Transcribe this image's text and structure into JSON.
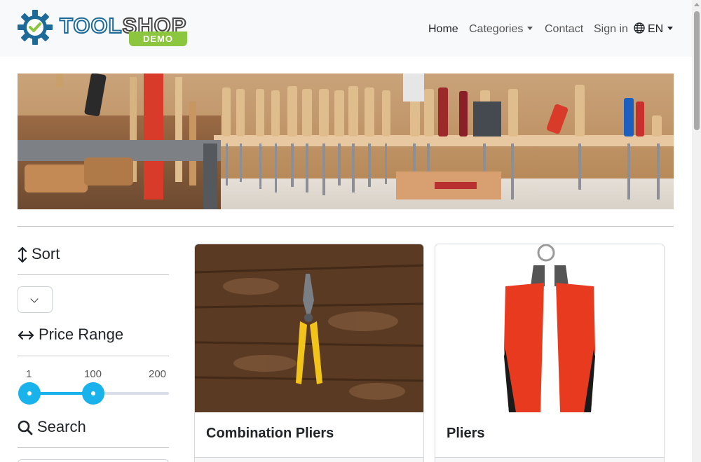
{
  "brand": {
    "name_part1": "TOOL",
    "name_part2": "SHOP",
    "tag": "DEMO"
  },
  "nav": {
    "home": "Home",
    "categories": "Categories",
    "contact": "Contact",
    "sign_in": "Sign in",
    "language": "EN"
  },
  "sidebar": {
    "sort_heading": "Sort",
    "sort_value": "",
    "price_heading": "Price Range",
    "price_min_label": "1",
    "price_current_label": "100",
    "price_max_label": "200",
    "price_range": {
      "min": 1,
      "low": 1,
      "high": 100,
      "max": 200
    },
    "search_heading": "Search"
  },
  "products": [
    {
      "name": "Combination Pliers"
    },
    {
      "name": "Pliers"
    }
  ],
  "colors": {
    "accent": "#1ab2ea",
    "brand_blue": "#1d6a98",
    "demo_green": "#8cc63f"
  }
}
